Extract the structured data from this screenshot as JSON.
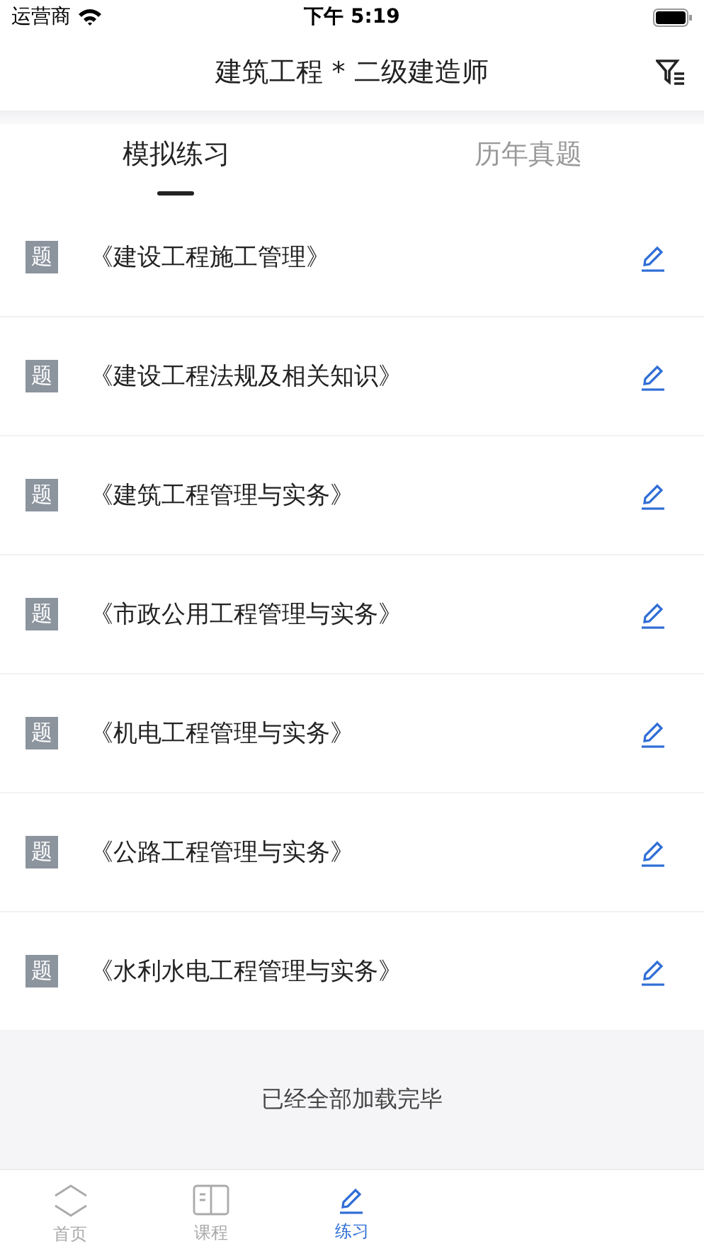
{
  "status_bar": {
    "carrier": "运营商",
    "time": "下午 5:19"
  },
  "nav_bar": {
    "title": "建筑工程 * 二级建造师"
  },
  "tabs": [
    {
      "label": "模拟练习",
      "selected": true
    },
    {
      "label": "历年真题",
      "selected": false
    }
  ],
  "list": [
    {
      "badge": "题",
      "title": "《建设工程施工管理》"
    },
    {
      "badge": "题",
      "title": "《建设工程法规及相关知识》"
    },
    {
      "badge": "题",
      "title": "《建筑工程管理与实务》"
    },
    {
      "badge": "题",
      "title": "《市政公用工程管理与实务》"
    },
    {
      "badge": "题",
      "title": "《机电工程管理与实务》"
    },
    {
      "badge": "题",
      "title": "《公路工程管理与实务》"
    },
    {
      "badge": "题",
      "title": "《水利水电工程管理与实务》"
    }
  ],
  "footer": "已经全部加载完毕",
  "tab_bar": [
    {
      "kind": "home",
      "label": "首页",
      "selected": false
    },
    {
      "kind": "course",
      "label": "课程",
      "selected": false
    },
    {
      "kind": "practice",
      "label": "练习",
      "selected": true
    }
  ]
}
